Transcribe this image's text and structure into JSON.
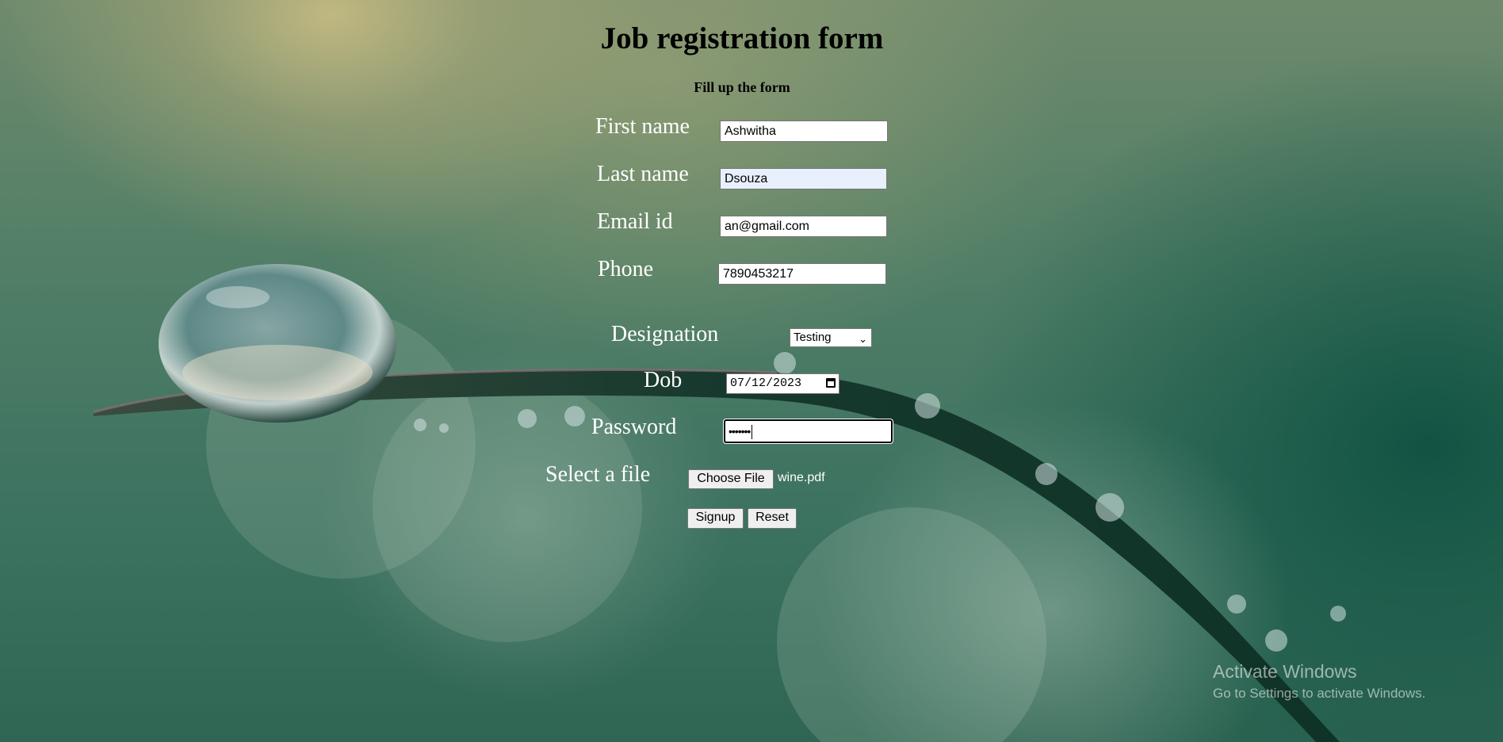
{
  "form": {
    "title": "Job registration form",
    "subtitle": "Fill up the form",
    "first_name": {
      "label": "First name",
      "value": "Ashwitha"
    },
    "last_name": {
      "label": "Last name",
      "value": "Dsouza"
    },
    "email": {
      "label": "Email id",
      "value": "an@gmail.com"
    },
    "phone": {
      "label": "Phone",
      "value": "7890453217"
    },
    "designation": {
      "label": "Designation",
      "selected": "Testing"
    },
    "dob": {
      "label": "Dob",
      "value": "07/12/2023"
    },
    "password": {
      "label": "Password",
      "masked": "•••••••"
    },
    "file": {
      "label": "Select a file",
      "button_label": "Choose File",
      "file_name": "wine.pdf"
    },
    "buttons": {
      "signup": "Signup",
      "reset": "Reset"
    }
  },
  "watermark": {
    "title": "Activate Windows",
    "subtitle": "Go to Settings to activate Windows."
  },
  "icons": {
    "select_chevron": "chevron-down-icon",
    "date_picker": "calendar-icon"
  }
}
